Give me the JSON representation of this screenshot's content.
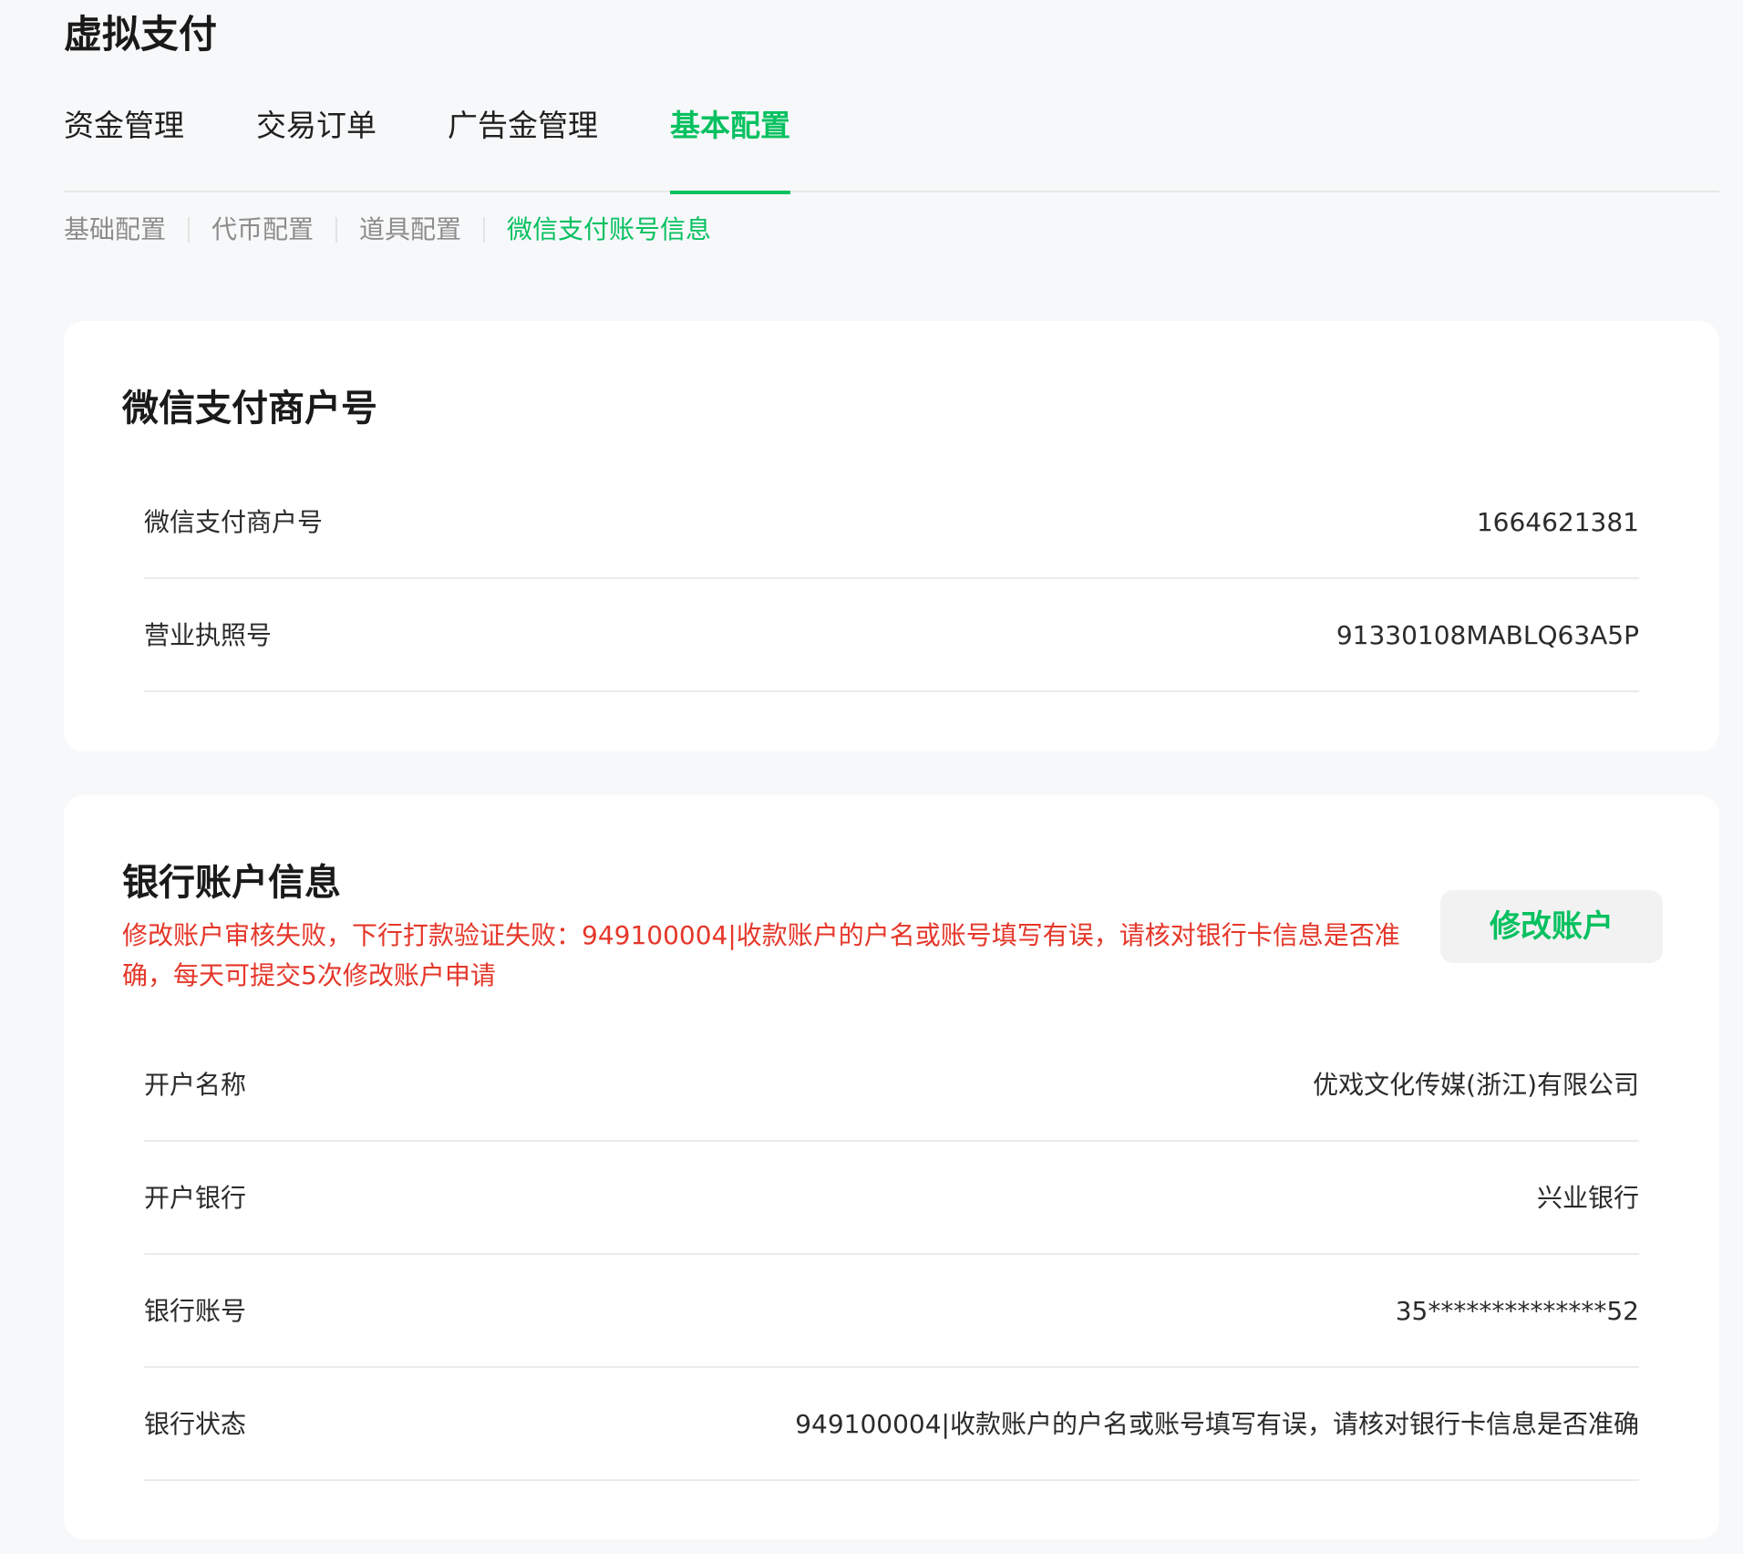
{
  "page_title": "虚拟支付",
  "main_tabs": [
    {
      "label": "资金管理"
    },
    {
      "label": "交易订单"
    },
    {
      "label": "广告金管理"
    },
    {
      "label": "基本配置"
    }
  ],
  "active_main_tab": "基本配置",
  "sub_tabs": [
    {
      "label": "基础配置"
    },
    {
      "label": "代币配置"
    },
    {
      "label": "道具配置"
    },
    {
      "label": "微信支付账号信息"
    }
  ],
  "active_sub_tab": "微信支付账号信息",
  "merchant_card": {
    "title": "微信支付商户号",
    "rows": [
      {
        "label": "微信支付商户号",
        "value": "1664621381"
      },
      {
        "label": "营业执照号",
        "value": "91330108MABLQ63A5P"
      }
    ]
  },
  "bank_card": {
    "title": "银行账户信息",
    "error_message": "修改账户审核失败，下行打款验证失败：949100004|收款账户的户名或账号填写有误，请核对银行卡信息是否准确，每天可提交5次修改账户申请",
    "edit_button": "修改账户",
    "rows": [
      {
        "label": "开户名称",
        "value": "优戏文化传媒(浙江)有限公司"
      },
      {
        "label": "开户银行",
        "value": "兴业银行"
      },
      {
        "label": "银行账号",
        "value": "35**************52"
      },
      {
        "label": "银行状态",
        "value": "949100004|收款账户的户名或账号填写有误，请核对银行卡信息是否准确"
      }
    ]
  },
  "colors": {
    "accent": "#07c160",
    "error": "#e5372a",
    "background": "#f7f8f9",
    "card": "#ffffff"
  }
}
